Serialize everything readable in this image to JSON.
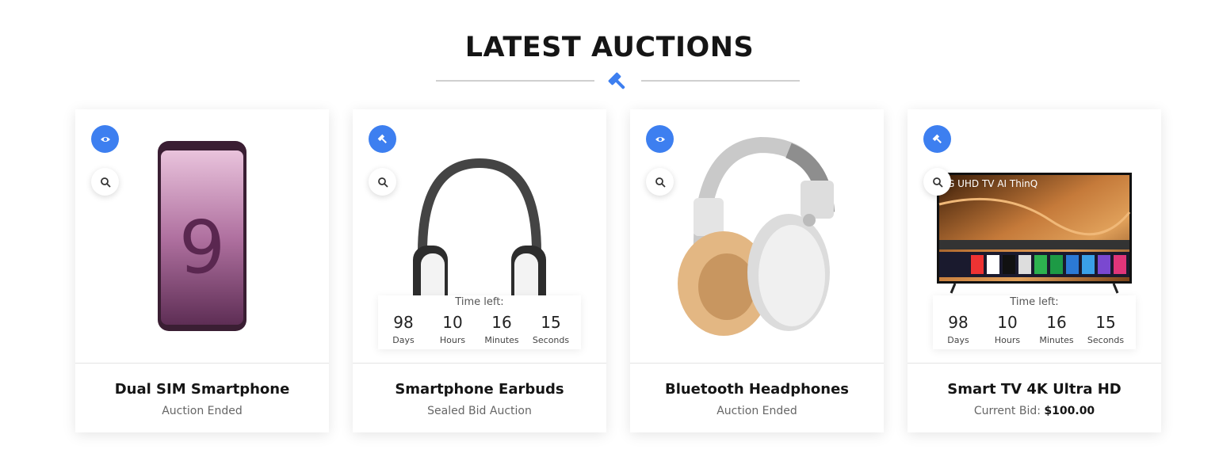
{
  "section": {
    "title": "LATEST AUCTIONS"
  },
  "cards": [
    {
      "title": "Dual SIM Smartphone",
      "subtitle": "Auction Ended",
      "badge_icon": "eye-icon",
      "image": "smartphone"
    },
    {
      "title": "Smartphone Earbuds",
      "subtitle": "Sealed Bid Auction",
      "badge_icon": "gavel-icon",
      "image": "headphones-black",
      "countdown": {
        "label": "Time left:",
        "days": "98",
        "hours": "10",
        "minutes": "16",
        "seconds": "15",
        "days_label": "Days",
        "hours_label": "Hours",
        "minutes_label": "Minutes",
        "seconds_label": "Seconds"
      }
    },
    {
      "title": "Bluetooth Headphones",
      "subtitle": "Auction Ended",
      "badge_icon": "eye-icon",
      "image": "headphones-white"
    },
    {
      "title": "Smart TV 4K Ultra HD",
      "subtitle_prefix": "Current Bid:",
      "subtitle_value": "$100.00",
      "badge_icon": "gavel-icon",
      "image": "smart-tv",
      "tv_screen_text": "G UHD TV AI ThinQ",
      "countdown": {
        "label": "Time left:",
        "days": "98",
        "hours": "10",
        "minutes": "16",
        "seconds": "15",
        "days_label": "Days",
        "hours_label": "Hours",
        "minutes_label": "Minutes",
        "seconds_label": "Seconds"
      }
    }
  ],
  "colors": {
    "accent": "#3d7ff0",
    "title": "#151515",
    "muted": "#666666"
  }
}
